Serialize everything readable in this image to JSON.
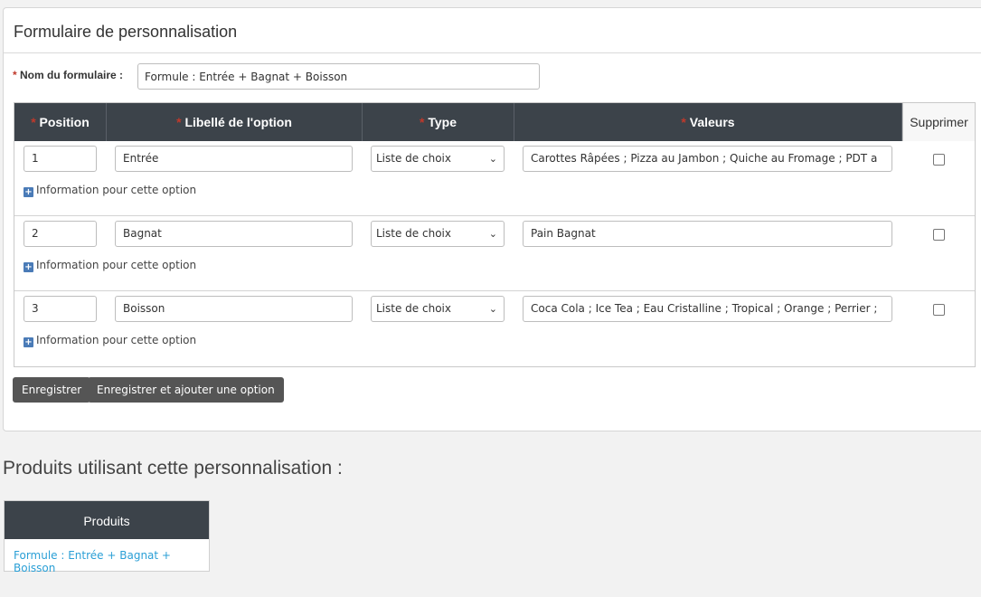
{
  "form": {
    "title": "Formulaire de personnalisation",
    "name_label": "Nom du formulaire :",
    "name_value": "Formule : Entrée + Bagnat + Boisson",
    "required_mark": "*"
  },
  "table": {
    "headers": {
      "position": "Position",
      "label": "Libellé de l'option",
      "type": "Type",
      "values": "Valeurs",
      "delete": "Supprimer"
    },
    "rows": [
      {
        "position": "1",
        "label": "Entrée",
        "type": "Liste de choix",
        "values": "Carottes Râpées ; Pizza au Jambon ; Quiche au Fromage ; PDT a",
        "info": "Information pour cette option",
        "delete_checked": false
      },
      {
        "position": "2",
        "label": "Bagnat",
        "type": "Liste de choix",
        "values": "Pain Bagnat",
        "info": "Information pour cette option",
        "delete_checked": false
      },
      {
        "position": "3",
        "label": "Boisson",
        "type": "Liste de choix",
        "values": "Coca Cola ; Ice Tea ; Eau Cristalline ; Tropical ; Orange ; Perrier ;",
        "info": "Information pour cette option",
        "delete_checked": false
      }
    ]
  },
  "buttons": {
    "save": "Enregistrer",
    "save_add": "Enregistrer et ajouter une option"
  },
  "products": {
    "title": "Produits utilisant cette personnalisation :",
    "column": "Produits",
    "items": [
      "Formule : Entrée + Bagnat + Boisson"
    ]
  },
  "icons": {
    "plus": "plus-square-icon",
    "chevron": "chevron-down-icon",
    "checkbox": "checkbox-icon"
  },
  "colors": {
    "header_bg": "#3c434a",
    "button_bg": "#555555",
    "required": "#c0392b",
    "link": "#2a9fd6",
    "plus_icon": "#4a7bb7"
  }
}
